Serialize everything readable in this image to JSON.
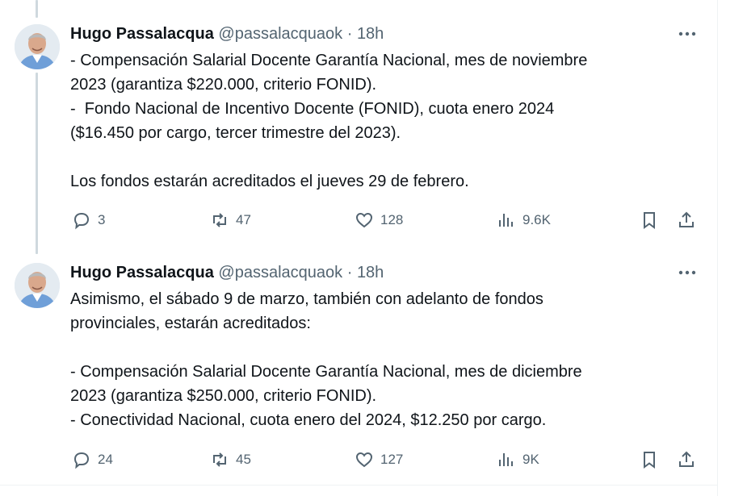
{
  "tweets": [
    {
      "author_name": "Hugo Passalacqua",
      "handle": "@passalacquaok",
      "separator": "·",
      "time": "18h",
      "text": "- Compensación Salarial Docente Garantía Nacional, mes de noviembre\n2023 (garantiza $220.000, criterio FONID).\n-  Fondo Nacional de Incentivo Docente (FONID), cuota enero 2024\n($16.450 por cargo, tercer trimestre del 2023).\n\nLos fondos estarán acreditados el jueves 29 de febrero.",
      "replies": "3",
      "retweets": "47",
      "likes": "128",
      "views": "9.6K"
    },
    {
      "author_name": "Hugo Passalacqua",
      "handle": "@passalacquaok",
      "separator": "·",
      "time": "18h",
      "text": "Asimismo, el sábado 9 de marzo, también con adelanto de fondos\nprovinciales, estarán acreditados:\n\n- Compensación Salarial Docente Garantía Nacional, mes de diciembre\n2023 (garantiza $250.000, criterio FONID).\n- Conectividad Nacional, cuota enero del 2024, $12.250 por cargo.",
      "replies": "24",
      "retweets": "45",
      "likes": "127",
      "views": "9K"
    }
  ],
  "icons": {
    "reply": "reply-icon",
    "retweet": "retweet-icon",
    "like": "like-icon",
    "views": "views-icon",
    "bookmark": "bookmark-icon",
    "share": "share-icon",
    "more": "more-icon"
  },
  "colors": {
    "text": "#0f1419",
    "secondary": "#536471",
    "thread_line": "#cfd9de",
    "divider": "#eff3f4"
  }
}
